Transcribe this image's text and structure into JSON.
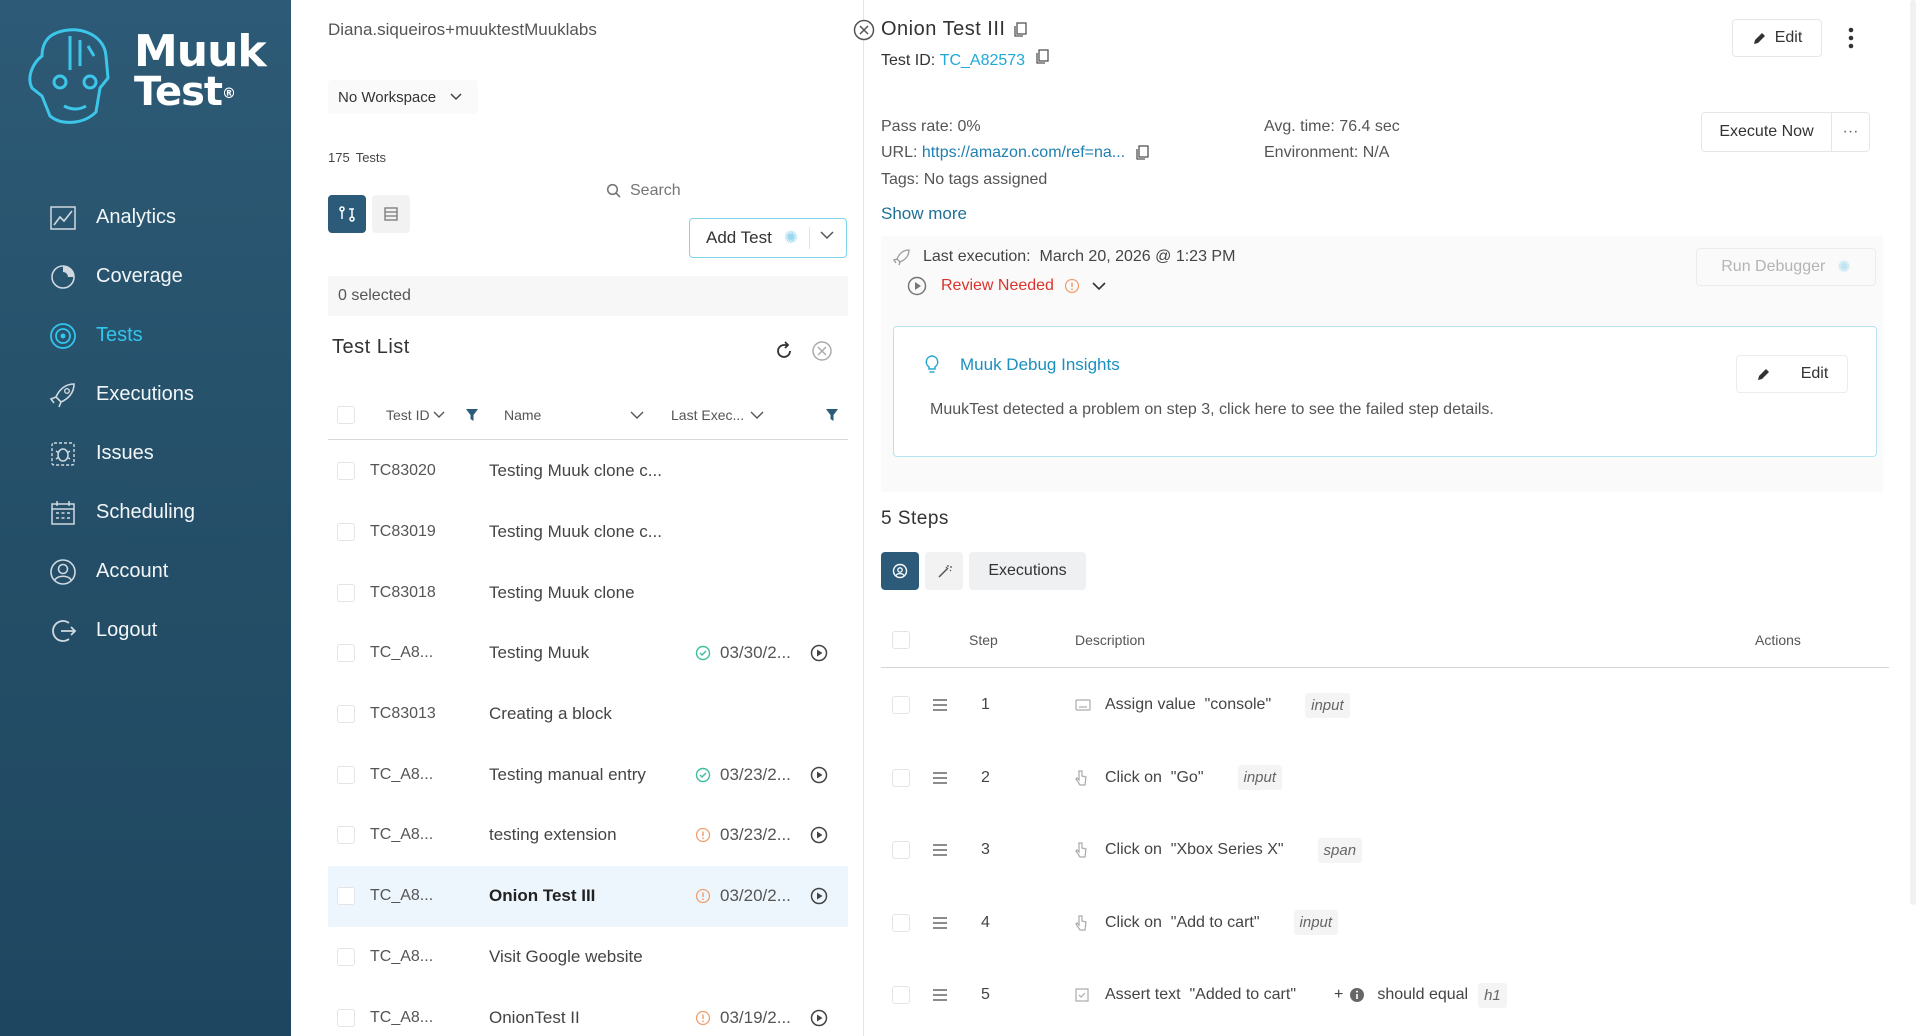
{
  "logo": {
    "line1": "Muuk",
    "line2": "Test",
    "reg": "®"
  },
  "sidebar": {
    "items": [
      {
        "label": "Analytics",
        "icon": "analytics-icon"
      },
      {
        "label": "Coverage",
        "icon": "coverage-icon"
      },
      {
        "label": "Tests",
        "icon": "tests-icon",
        "active": true
      },
      {
        "label": "Executions",
        "icon": "rocket-icon"
      },
      {
        "label": "Issues",
        "icon": "bug-icon"
      },
      {
        "label": "Scheduling",
        "icon": "calendar-icon"
      },
      {
        "label": "Account",
        "icon": "user-icon"
      },
      {
        "label": "Logout",
        "icon": "logout-icon"
      }
    ]
  },
  "list_panel": {
    "user": "Diana.siqueiros+muuktestMuuklabs",
    "workspace": "No Workspace",
    "count": "175",
    "count_label": "Tests",
    "search_placeholder": "Search",
    "add_test": "Add Test",
    "selected": "0 selected",
    "title": "Test List",
    "columns": {
      "id": "Test ID",
      "name": "Name",
      "last": "Last Exec..."
    },
    "rows": [
      {
        "id": "TC83020",
        "name": "Testing Muuk clone c...",
        "status": "",
        "date": ""
      },
      {
        "id": "TC83019",
        "name": "Testing Muuk clone c...",
        "status": "",
        "date": ""
      },
      {
        "id": "TC83018",
        "name": "Testing Muuk clone",
        "status": "",
        "date": ""
      },
      {
        "id": "TC_A8...",
        "name": "Testing Muuk",
        "status": "pass",
        "date": "03/30/2..."
      },
      {
        "id": "TC83013",
        "name": "Creating a block",
        "status": "",
        "date": ""
      },
      {
        "id": "TC_A8...",
        "name": "Testing manual entry",
        "status": "pass",
        "date": "03/23/2..."
      },
      {
        "id": "TC_A8...",
        "name": "testing extension",
        "status": "warn",
        "date": "03/23/2..."
      },
      {
        "id": "TC_A8...",
        "name": "Onion Test III",
        "status": "warn",
        "date": "03/20/2...",
        "selected": true
      },
      {
        "id": "TC_A8...",
        "name": "Visit Google website",
        "status": "",
        "date": ""
      },
      {
        "id": "TC_A8...",
        "name": "OnionTest II",
        "status": "warn",
        "date": "03/19/2..."
      }
    ]
  },
  "detail": {
    "title": "Onion Test III",
    "test_id_label": "Test ID:",
    "test_id": "TC_A82573",
    "edit": "Edit",
    "pass_rate": "Pass rate: 0%",
    "avg_time": "Avg. time: 76.4 sec",
    "url_label": "URL:",
    "url": "https://amazon.com/ref=na...",
    "environment": "Environment: N/A",
    "tags": "Tags: No tags assigned",
    "execute_now": "Execute Now",
    "show_more": "Show more",
    "last_execution_label": "Last execution:",
    "last_execution": "March 20, 2026 @ 1:23 PM",
    "review": "Review Needed",
    "run_debugger": "Run Debugger",
    "insights_title": "Muuk Debug Insights",
    "insights_edit": "Edit",
    "insights_msg": "MuukTest detected a problem on step 3, click here to see the failed step details.",
    "steps_title": "5 Steps",
    "executions_tab": "Executions",
    "step_columns": {
      "step": "Step",
      "description": "Description",
      "actions": "Actions"
    },
    "steps": [
      {
        "n": "1",
        "action": "Assign value",
        "target": "\"console\"",
        "tag": "input",
        "icon": "keyboard-icon"
      },
      {
        "n": "2",
        "action": "Click on",
        "target": "\"Go\"",
        "tag": "input",
        "icon": "pointer-icon"
      },
      {
        "n": "3",
        "action": "Click on",
        "target": "\"Xbox Series X\"",
        "tag": "span",
        "icon": "pointer-icon"
      },
      {
        "n": "4",
        "action": "Click on",
        "target": "\"Add to cart\"",
        "tag": "input",
        "icon": "pointer-icon"
      },
      {
        "n": "5",
        "action": "Assert text",
        "target": "\"Added to cart\"",
        "extra_plus": "+",
        "extra": "should equal",
        "tag": "h1",
        "icon": "assert-icon"
      }
    ]
  },
  "colors": {
    "sidebar": "#2d5a76",
    "accent": "#32c5ee",
    "link": "#1fa9d6",
    "danger": "#d9342b",
    "pass": "#3fbfa0"
  }
}
